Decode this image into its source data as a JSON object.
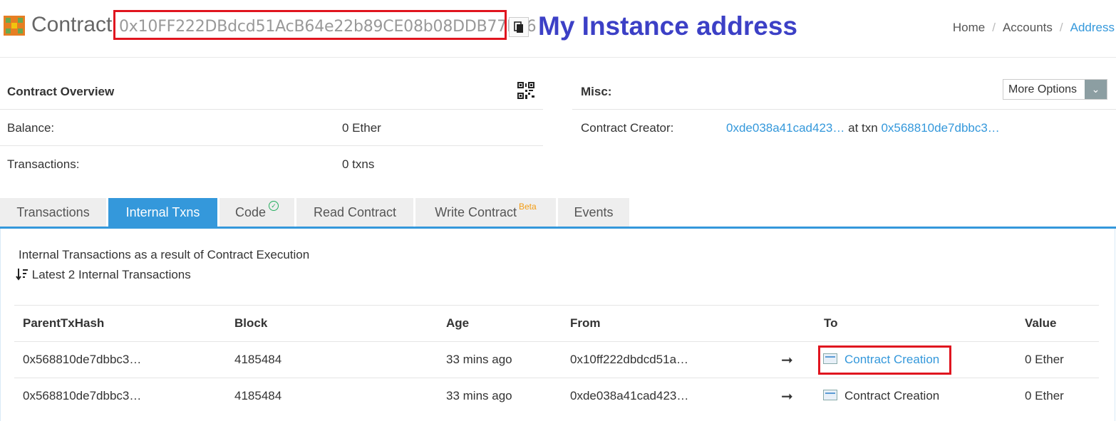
{
  "header": {
    "title": "Contract",
    "address": "0x10FF222DBdcd51AcB64e22b89CE08b08DDB77E86",
    "annotation": "My Instance address",
    "breadcrumb": [
      "Home",
      "Accounts",
      "Address"
    ]
  },
  "overview": {
    "heading": "Contract Overview",
    "balance_label": "Balance:",
    "balance_value": "0 Ether",
    "transactions_label": "Transactions:",
    "transactions_value": "0 txns"
  },
  "misc": {
    "heading": "Misc:",
    "more_options": "More Options",
    "creator_label": "Contract Creator:",
    "creator_address": "0xde038a41cad423…",
    "at_txn": "at txn",
    "creator_txn": "0x568810de7dbbc3…"
  },
  "tabs": [
    {
      "label": "Transactions"
    },
    {
      "label": "Internal Txns",
      "active": true
    },
    {
      "label": "Code"
    },
    {
      "label": "Read Contract"
    },
    {
      "label": "Write Contract",
      "badge": "Beta"
    },
    {
      "label": "Events"
    }
  ],
  "internal": {
    "description": "Internal Transactions as a result of Contract Execution",
    "summary": "Latest 2 Internal Transactions",
    "columns": [
      "ParentTxHash",
      "Block",
      "Age",
      "From",
      "To",
      "Value"
    ],
    "rows": [
      {
        "parent": "0x568810de7dbbc3…",
        "block": "4185484",
        "age": "33 mins ago",
        "from": "0x10ff222dbdcd51a…",
        "arrow": "➞",
        "to": "Contract Creation",
        "value": "0 Ether"
      },
      {
        "parent": "0x568810de7dbbc3…",
        "block": "4185484",
        "age": "33 mins ago",
        "from": "0xde038a41cad423…",
        "arrow": "➞",
        "to": "Contract Creation",
        "value": "0 Ether"
      }
    ]
  },
  "colors": {
    "accent": "#3498db",
    "annotation": "#3c40c6",
    "highlight_box": "#e0151f",
    "tab_inactive": "#eeeeee"
  },
  "icons": {
    "logo": "contract-logo-icon",
    "copy": "copy-icon",
    "qr": "qr-code-icon",
    "sort": "sort-icon",
    "contract_creation": "contract-creation-icon",
    "arrow": "right-arrow-icon",
    "verified": "check-circle-icon"
  }
}
